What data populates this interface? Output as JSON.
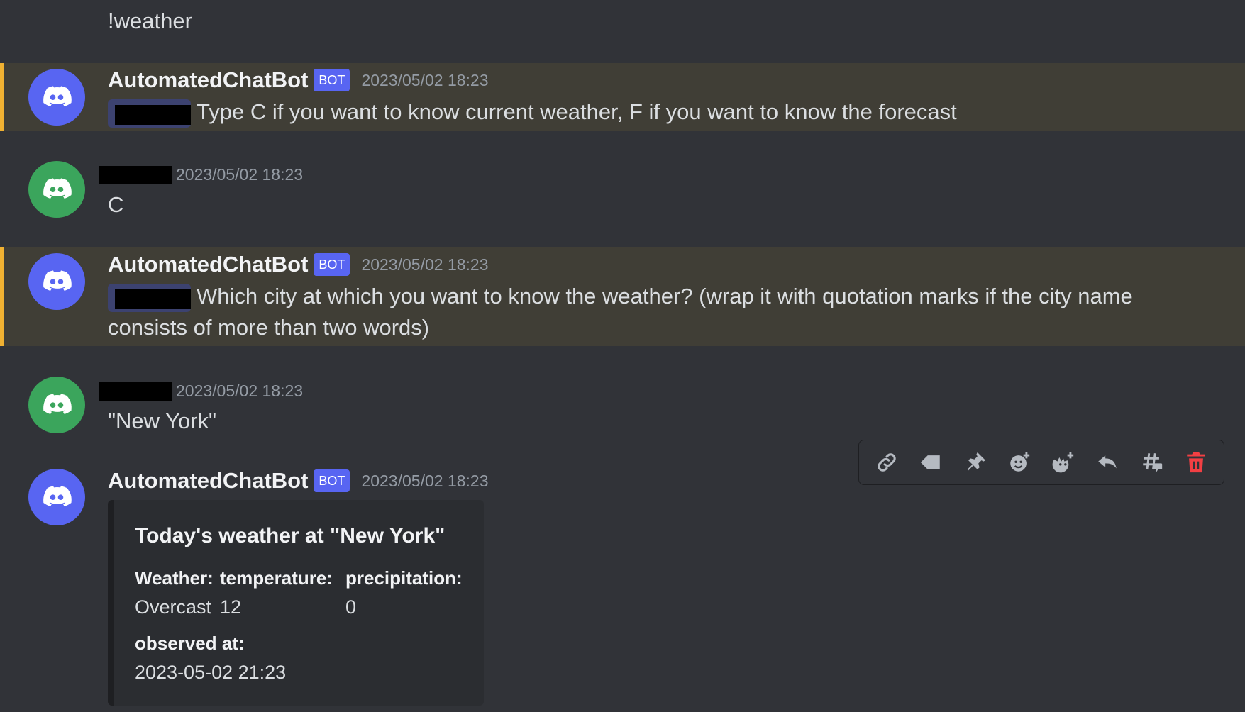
{
  "messages": [
    {
      "type": "continuation",
      "text": "!weather"
    },
    {
      "author": "AutomatedChatBot",
      "bot_tag": "BOT",
      "timestamp": "2023/05/02 18:23",
      "text": "Type C if you want to know current weather, F if you want to know the forecast",
      "highlighted": true
    },
    {
      "author": "[redacted]",
      "timestamp": "2023/05/02 18:23",
      "text": "C"
    },
    {
      "author": "AutomatedChatBot",
      "bot_tag": "BOT",
      "timestamp": "2023/05/02 18:23",
      "text": "Which city at which you want to know the weather? (wrap it with quotation marks if the city name consists of more than two words)",
      "highlighted": true
    },
    {
      "author": "[redacted]",
      "timestamp": "2023/05/02 18:23",
      "text": "\"New York\""
    },
    {
      "author": "AutomatedChatBot",
      "bot_tag": "BOT",
      "timestamp": "2023/05/02 18:23"
    }
  ],
  "embed": {
    "title": "Today's weather at \"New York\"",
    "fields": [
      {
        "name": "Weather:",
        "value": "Overcast"
      },
      {
        "name": "temperature:",
        "value": "12"
      },
      {
        "name": "precipitation:",
        "value": "0"
      },
      {
        "name": "observed at:",
        "value": "2023-05-02 21:23"
      }
    ]
  },
  "toolbar": {
    "icons": [
      "link-icon",
      "tag-icon",
      "pin-icon",
      "add-reaction-icon",
      "add-super-reaction-icon",
      "reply-icon",
      "create-thread-icon",
      "delete-icon"
    ],
    "delete_color": "#f23f43"
  },
  "colors": {
    "background": "#313338",
    "highlight": "#403e36",
    "mention_border": "#f0b132",
    "bot_blurple": "#5865f2",
    "user_avatar_green": "#3ba55c"
  }
}
